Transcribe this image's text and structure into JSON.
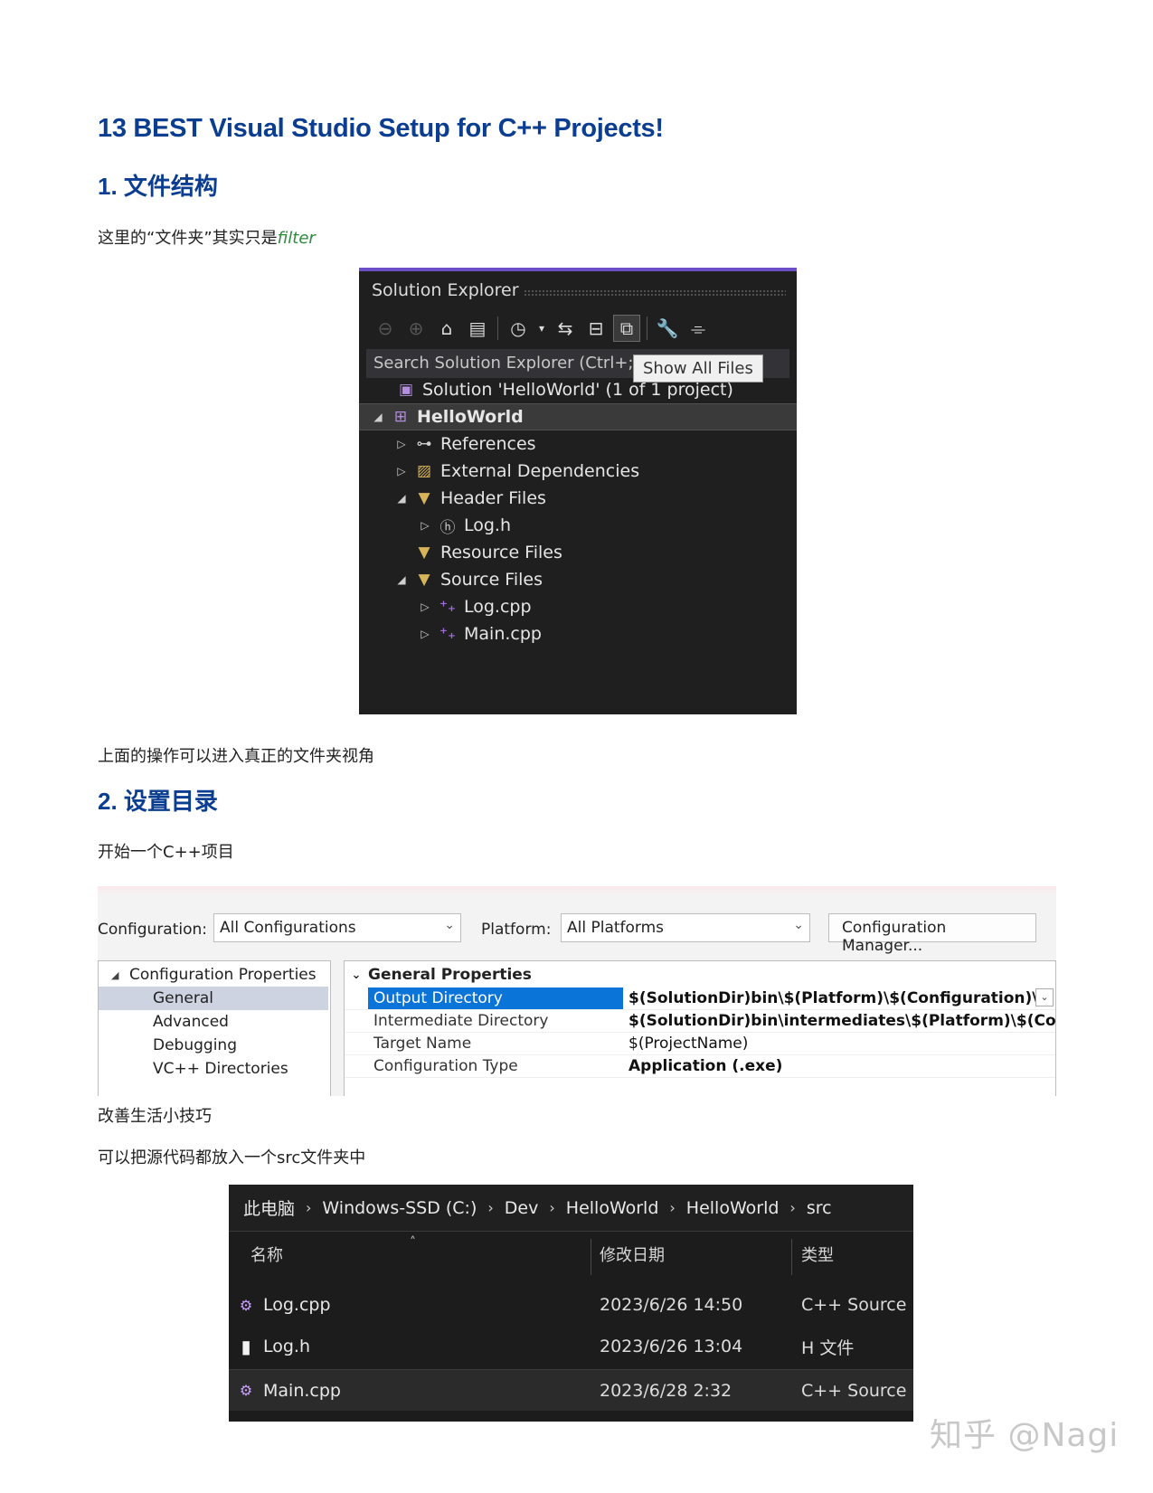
{
  "doc": {
    "title": "13 BEST Visual Studio Setup for C++ Projects!",
    "section1": "1. 文件结构",
    "p1_prefix": "这里的“文件夹”其实只是",
    "p1_em": "filter",
    "p2": "上面的操作可以进入真正的文件夹视角",
    "section2": "2. 设置目录",
    "p3": "开始一个C++项目",
    "p4": "改善生活小技巧",
    "p5": "可以把源代码都放入一个src文件夹中",
    "watermark": "知乎 @Nagi"
  },
  "solution_explorer": {
    "title": "Solution Explorer",
    "search_placeholder": "Search Solution Explorer (Ctrl+;",
    "tooltip": "Show All Files",
    "tree": [
      {
        "label": "Solution 'HelloWorld' (1 of 1 project)",
        "icon": "solution-icon"
      },
      {
        "label": "HelloWorld",
        "icon": "project-icon"
      },
      {
        "label": "References",
        "icon": "references-icon"
      },
      {
        "label": "External Dependencies",
        "icon": "external-deps-icon"
      },
      {
        "label": "Header Files",
        "icon": "filter-folder-icon"
      },
      {
        "label": "Log.h",
        "icon": "header-file-icon"
      },
      {
        "label": "Resource Files",
        "icon": "filter-folder-icon"
      },
      {
        "label": "Source Files",
        "icon": "filter-folder-icon"
      },
      {
        "label": "Log.cpp",
        "icon": "cpp-file-icon"
      },
      {
        "label": "Main.cpp",
        "icon": "cpp-file-icon"
      }
    ]
  },
  "property_pages": {
    "configuration_label": "Configuration:",
    "configuration_value": "All Configurations",
    "platform_label": "Platform:",
    "platform_value": "All Platforms",
    "config_manager_button": "Configuration Manager...",
    "tree": [
      {
        "label": "Configuration Properties"
      },
      {
        "label": "General"
      },
      {
        "label": "Advanced"
      },
      {
        "label": "Debugging"
      },
      {
        "label": "VC++ Directories"
      }
    ],
    "group_header": "General Properties",
    "rows": [
      {
        "name": "Output Directory",
        "value": "$(SolutionDir)bin\\$(Platform)\\$(Configuration)\\"
      },
      {
        "name": "Intermediate Directory",
        "value": "$(SolutionDir)bin\\intermediates\\$(Platform)\\$(Confi"
      },
      {
        "name": "Target Name",
        "value": "$(ProjectName)"
      },
      {
        "name": "Configuration Type",
        "value": "Application (.exe)"
      }
    ]
  },
  "file_explorer": {
    "breadcrumb": [
      "此电脑",
      "Windows-SSD (C:)",
      "Dev",
      "HelloWorld",
      "HelloWorld",
      "src"
    ],
    "columns": {
      "name": "名称",
      "date": "修改日期",
      "type": "类型"
    },
    "files": [
      {
        "name": "Log.cpp",
        "date": "2023/6/26 14:50",
        "type": "C++ Source",
        "icon": "cpp-file-icon"
      },
      {
        "name": "Log.h",
        "date": "2023/6/26 13:04",
        "type": "H 文件",
        "icon": "blank-file-icon"
      },
      {
        "name": "Main.cpp",
        "date": "2023/6/28 2:32",
        "type": "C++ Source",
        "icon": "cpp-file-icon"
      }
    ]
  },
  "colors": {
    "heading": "#0b3d91",
    "filter_text": "#2e8b3e",
    "vs_accent": "#6c4fc7",
    "selection_blue": "#0a74d9"
  }
}
